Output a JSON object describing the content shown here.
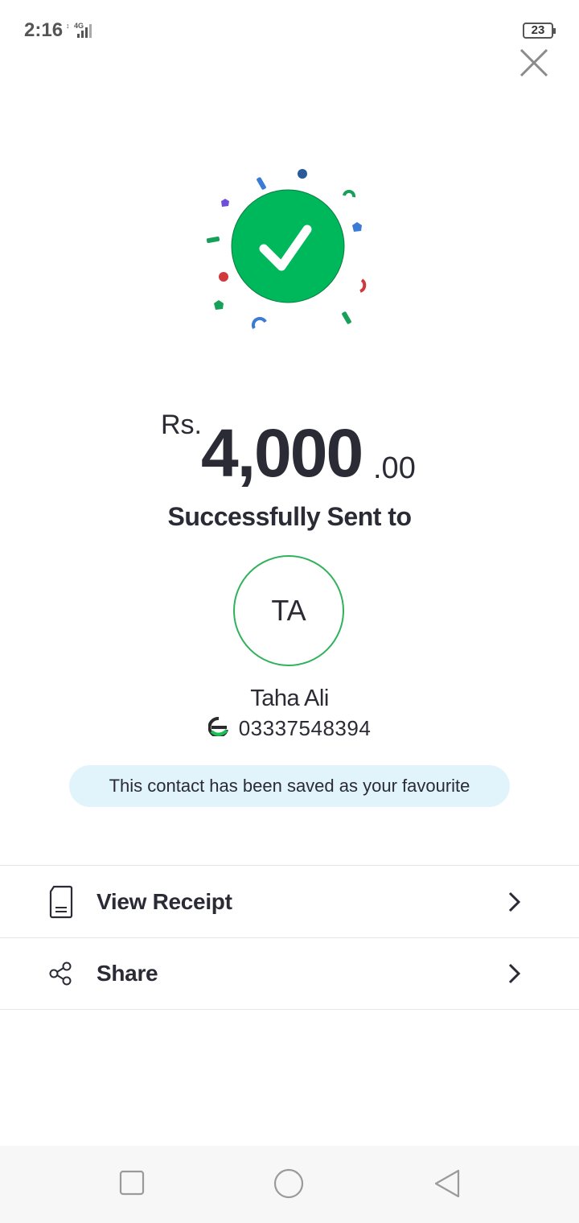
{
  "status_bar": {
    "time": "2:16",
    "network": "4G",
    "battery": "23"
  },
  "success": {
    "check_color": "#00b85c",
    "icon": "checkmark-icon"
  },
  "amount": {
    "currency": "Rs.",
    "whole": "4,000",
    "decimal": ".00"
  },
  "status_title": "Successfully Sent to",
  "recipient": {
    "initials": "TA",
    "name": "Taha Ali",
    "number": "03337548394",
    "wallet_icon": "easypaisa-icon"
  },
  "favourite_message": "This contact has been saved as your favourite",
  "menu": [
    {
      "label": "View Receipt",
      "icon": "receipt-icon"
    },
    {
      "label": "Share",
      "icon": "share-icon"
    }
  ],
  "colors": {
    "accent_green": "#2fb25b",
    "banner_bg": "#e1f3fb",
    "text": "#2b2b36"
  }
}
